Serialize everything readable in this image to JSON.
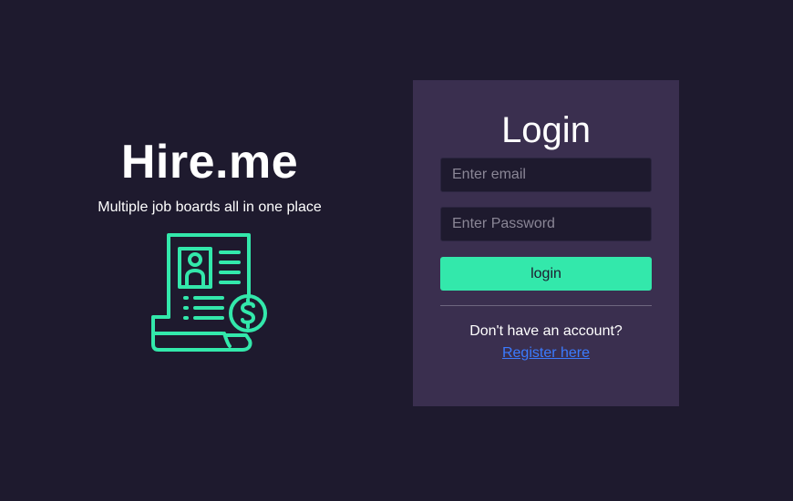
{
  "brand": {
    "title": "Hire.me",
    "tagline": "Multiple job boards all in one place",
    "illustration_icon": "resume-salary-icon",
    "accent_color": "#33e8ab"
  },
  "login": {
    "title": "Login",
    "email_placeholder": "Enter email",
    "email_value": "",
    "password_placeholder": "Enter Password",
    "password_value": "",
    "submit_label": "login",
    "signup_prompt": "Don't have an account?",
    "register_label": "Register here",
    "button_color": "#33e8ab",
    "link_color": "#3b7bff"
  },
  "theme": {
    "background": "#1e1a2e",
    "panel": "#3a2f4f"
  }
}
